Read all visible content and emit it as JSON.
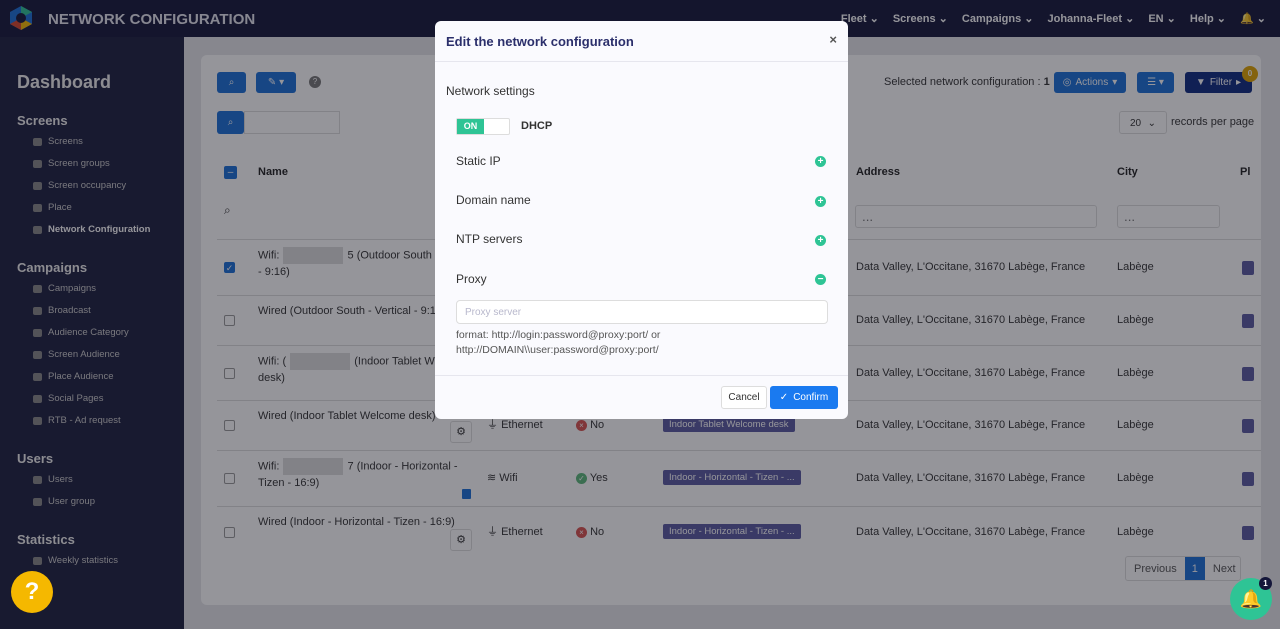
{
  "app": {
    "title": "NETWORK CONFIGURATION"
  },
  "nav": [
    "Fleet ⌄",
    "Screens ⌄",
    "Campaigns ⌄",
    "Johanna-Fleet ⌄",
    "EN ⌄",
    "Help ⌄",
    "🔔 ⌄"
  ],
  "sidebar": {
    "title": "Dashboard",
    "sections": [
      {
        "label": "Screens",
        "items": [
          "Screens",
          "Screen groups",
          "Screen occupancy",
          "Place",
          "Network Configuration"
        ]
      },
      {
        "label": "Campaigns",
        "items": [
          "Campaigns",
          "Broadcast",
          "Audience Category",
          "Screen Audience",
          "Place Audience",
          "Social Pages",
          "RTB - Ad request"
        ]
      },
      {
        "label": "Users",
        "items": [
          "Users",
          "User group"
        ]
      },
      {
        "label": "Statistics",
        "items": [
          "Weekly statistics"
        ]
      }
    ]
  },
  "toolbar": {
    "selected": "Selected network configuration : ",
    "selected_count": "1",
    "actions": "Actions",
    "filter": "Filter",
    "filter_badge": "0",
    "per_page": "20",
    "per_page_label": "records per page",
    "help": "?"
  },
  "table": {
    "headers": {
      "name": "Name",
      "address": "Address",
      "city": "City",
      "pl": "Pl"
    },
    "filter_placeholder": "...",
    "rows": [
      {
        "name_a": "Wifi:",
        "name_b": "5 (Outdoor South -",
        "name_c": "- 9:16)",
        "address": "Data Valley, L'Occitane, 31670 Labège, France",
        "city": "Labège",
        "checked": true
      },
      {
        "name_a": "Wired (Outdoor South - Vertical - 9:16",
        "name_b": "",
        "name_c": "",
        "address": "Data Valley, L'Occitane, 31670 Labège, France",
        "city": "Labège",
        "checked": false
      },
      {
        "name_a": "Wifi: (",
        "name_b": "(Indoor Tablet W",
        "name_c": "desk)",
        "address": "Data Valley, L'Occitane, 31670 Labège, France",
        "city": "Labège",
        "checked": false
      },
      {
        "name_a": "Wired (Indoor Tablet Welcome desk)",
        "name_b": "",
        "name_c": "",
        "type": "Ethernet",
        "dhcp": "No",
        "tag": "Indoor Tablet Welcome desk",
        "address": "Data Valley, L'Occitane, 31670 Labège, France",
        "city": "Labège",
        "checked": false
      },
      {
        "name_a": "Wifi:",
        "name_b": "7 (Indoor - Horizontal -",
        "name_c": "Tizen - 16:9)",
        "type": "Wifi",
        "dhcp": "Yes",
        "tag": "Indoor - Horizontal - Tizen - ...",
        "address": "Data Valley, L'Occitane, 31670 Labège, France",
        "city": "Labège",
        "checked": false
      },
      {
        "name_a": "Wired (Indoor - Horizontal - Tizen - 16:9)",
        "name_b": "",
        "name_c": "",
        "type": "Ethernet",
        "dhcp": "No",
        "tag": "Indoor - Horizontal - Tizen - ...",
        "address": "Data Valley, L'Occitane, 31670 Labège, France",
        "city": "Labège",
        "checked": false
      }
    ]
  },
  "pagination": {
    "previous": "Previous",
    "page": "1",
    "next": "Next"
  },
  "modal": {
    "title": "Edit the network configuration",
    "close": "×",
    "section": "Network settings",
    "toggle": "ON",
    "dhcp": "DHCP",
    "static_ip": "Static IP",
    "domain": "Domain name",
    "ntp": "NTP servers",
    "proxy": "Proxy",
    "proxy_placeholder": "Proxy server",
    "hint1": "format: http://login:password@proxy:port/ or",
    "hint2": "http://DOMAIN\\\\user:password@proxy:port/",
    "cancel": "Cancel",
    "confirm": "Confirm"
  },
  "notif_badge": "1"
}
